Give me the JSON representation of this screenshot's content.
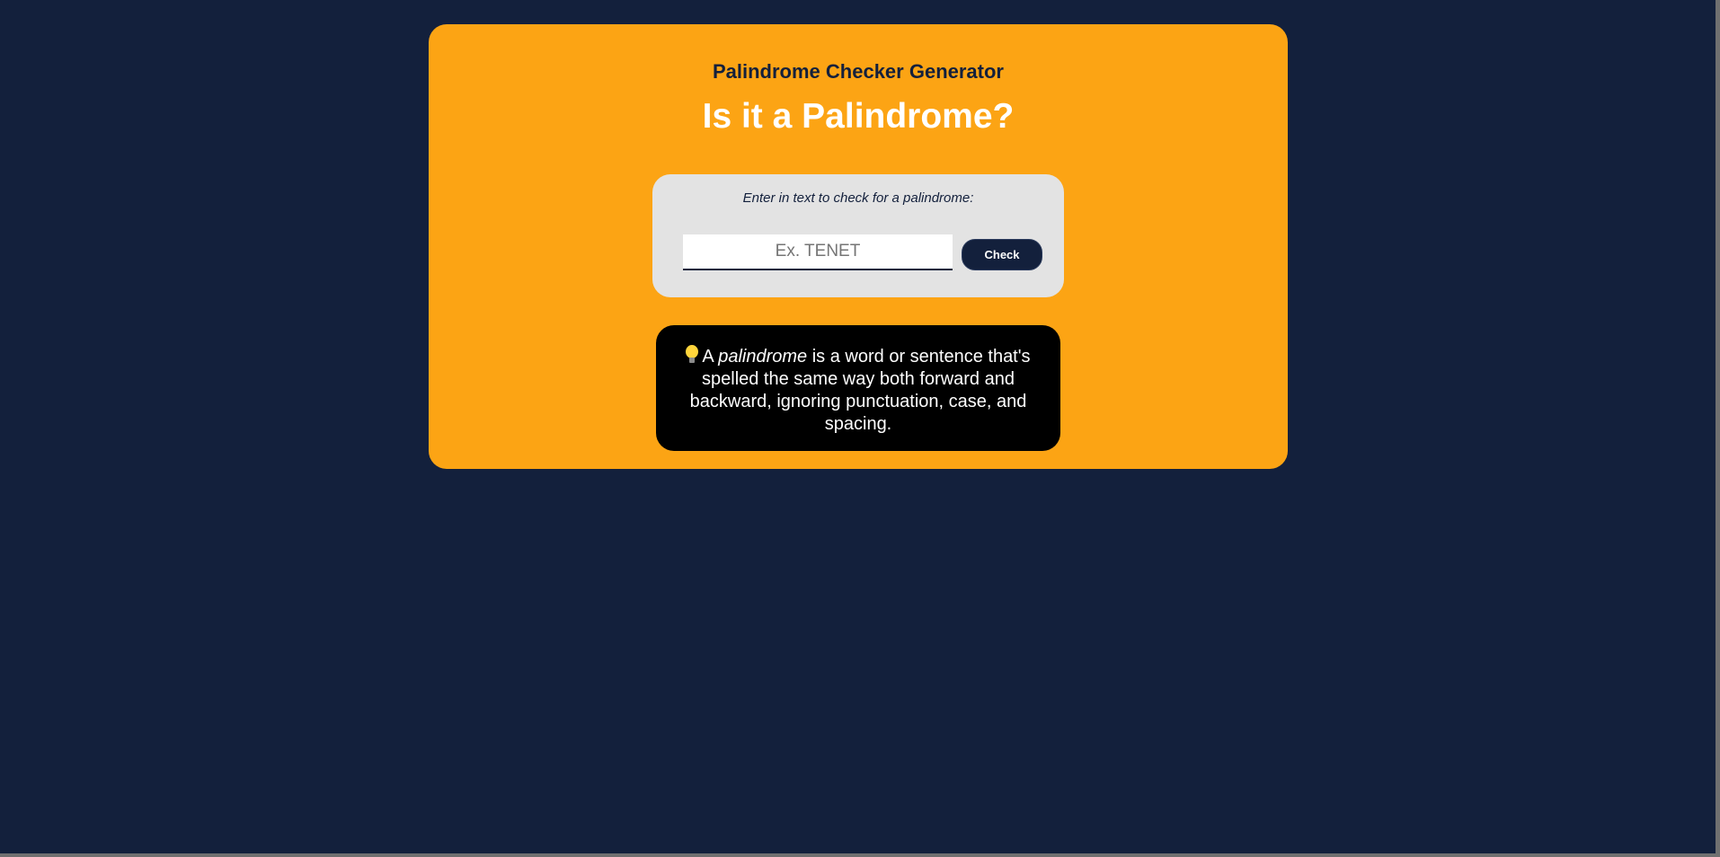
{
  "header": {
    "subtitle": "Palindrome Checker Generator",
    "title": "Is it a Palindrome?"
  },
  "input_panel": {
    "label": "Enter in text to check for a palindrome:",
    "input_value": "",
    "input_placeholder": "Ex. TENET",
    "check_button_label": "Check"
  },
  "info": {
    "icon": "lightbulb-icon",
    "prefix": "A ",
    "term": "palindrome",
    "definition": " is a word or sentence that's spelled the same way both forward and backward, ignoring punctuation, case, and spacing."
  },
  "colors": {
    "background": "#13203c",
    "card": "#fca414",
    "panel": "#e3e3e3",
    "info_box": "#000000",
    "button": "#13203c"
  }
}
